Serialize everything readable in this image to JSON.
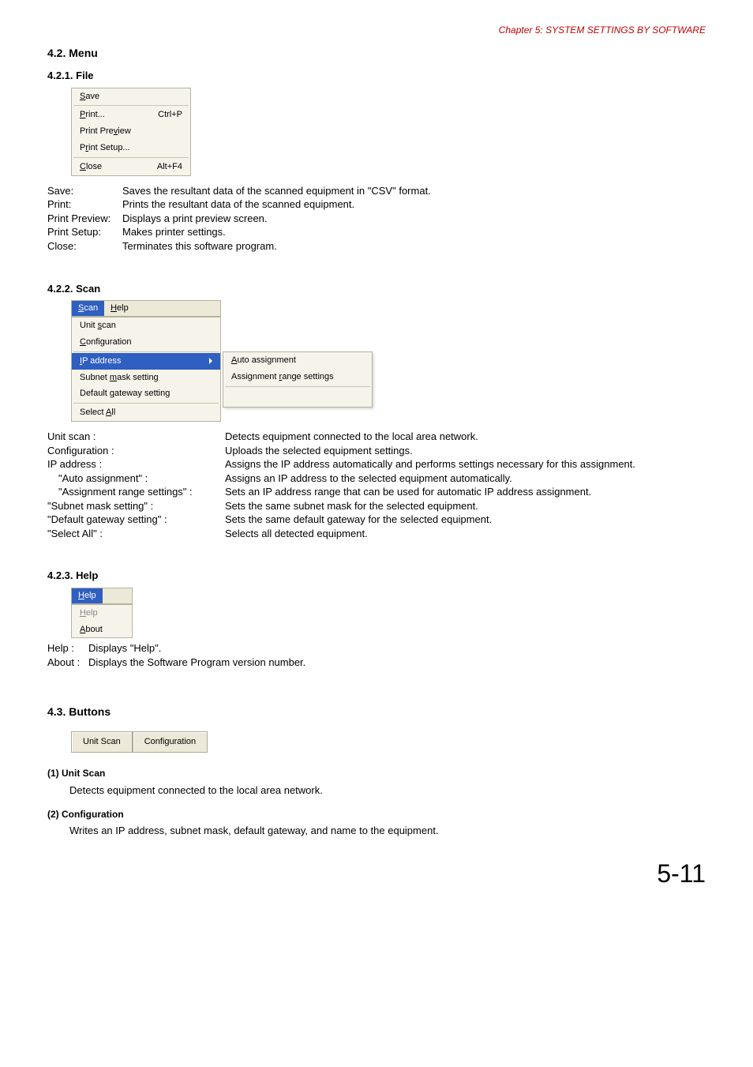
{
  "chapter_header": "Chapter 5:  SYSTEM SETTINGS BY SOFTWARE",
  "h2_menu": "4.2. Menu",
  "file": {
    "heading": "4.2.1. File",
    "menu": {
      "save": "Save",
      "print": "Print...",
      "print_key": "Ctrl+P",
      "preview_pre": "Print Pre",
      "preview_u": "v",
      "preview_post": "iew",
      "setup_pre": "P",
      "setup_u": "r",
      "setup_post": "int Setup...",
      "close": "Close",
      "close_key": "Alt+F4"
    },
    "defs": {
      "save_t": "Save:",
      "save_d": "Saves the resultant data of the scanned equipment in \"CSV\" format.",
      "print_t": "Print:",
      "print_d": "Prints the resultant data of the scanned equipment.",
      "preview_t": "Print Preview:",
      "preview_d": "Displays a print preview screen.",
      "setup_t": "Print Setup:",
      "setup_d": "Makes printer settings.",
      "close_t": "Close:",
      "close_d": "Terminates this software program."
    }
  },
  "scan": {
    "heading": "4.2.2. Scan",
    "menubar": {
      "scan_u": "S",
      "scan_rest": "can",
      "help_u": "H",
      "help_rest": "elp"
    },
    "menu": {
      "unit_pre": "Unit ",
      "unit_u": "s",
      "unit_post": "can",
      "config_u": "C",
      "config_post": "onfiguration",
      "ip_u": "I",
      "ip_post": "P address",
      "subnet_pre": "Subnet ",
      "subnet_u": "m",
      "subnet_post": "ask setting",
      "gw_pre": "Default ",
      "gw_u": "g",
      "gw_post": "ateway setting",
      "selall_pre": "Select ",
      "selall_u": "A",
      "selall_post": "ll"
    },
    "sub": {
      "auto_u": "A",
      "auto_post": "uto assignment",
      "range_pre": "Assignment ",
      "range_u": "r",
      "range_post": "ange settings"
    },
    "defs": {
      "unit_t": "Unit scan :",
      "unit_d": "Detects equipment connected to the local area network.",
      "config_t": "Configuration :",
      "config_d": "Uploads the selected equipment settings.",
      "ip_t": "IP address :",
      "ip_d": "Assigns the IP address automatically and performs settings necessary for this assignment.",
      "auto_t": "\"Auto assignment\" :",
      "auto_d": "Assigns an IP address to the selected equipment automatically.",
      "range_t": "\"Assignment range settings\" :",
      "range_d": "Sets an IP address range that can be used for automatic IP address assignment.",
      "subnet_t": "\"Subnet mask setting\" :",
      "subnet_d": "Sets the same subnet mask for the selected equipment.",
      "gw_t": "\"Default gateway setting\" :",
      "gw_d": "Sets the same default gateway for the selected equipment.",
      "selall_t": "\"Select All\" :",
      "selall_d": "Selects all detected equipment."
    }
  },
  "help": {
    "heading": "4.2.3. Help",
    "menubar": {
      "u": "H",
      "rest": "elp"
    },
    "menu": {
      "help_u": "H",
      "help_rest": "elp",
      "about_u": "A",
      "about_rest": "bout"
    },
    "defs": {
      "help_t": "Help :",
      "help_d": "Displays \"Help\".",
      "about_t": "About :",
      "about_d": "Displays the Software Program version number."
    }
  },
  "h2_buttons": "4.3. Buttons",
  "toolbar": {
    "unit_scan": "Unit Scan",
    "configuration": "Configuration"
  },
  "buttons_desc": {
    "t1": "(1) Unit Scan",
    "d1": "Detects equipment connected to the local area network.",
    "t2": "(2) Configuration",
    "d2": "Writes an IP address, subnet mask, default gateway, and name to the equipment."
  },
  "page_number": "5-11"
}
